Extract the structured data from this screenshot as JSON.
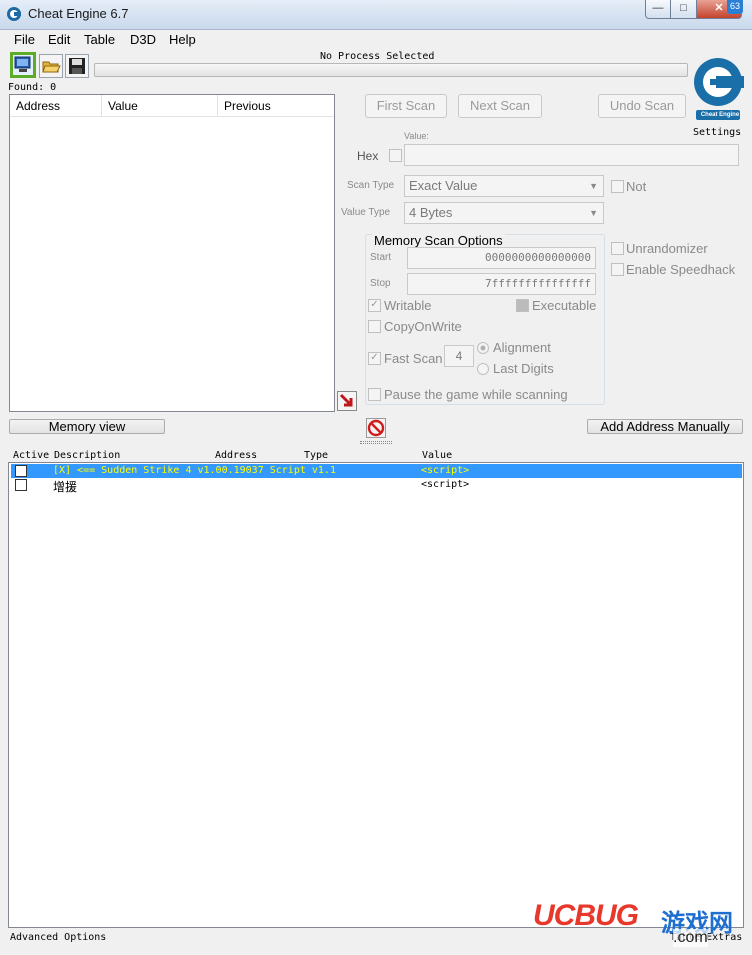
{
  "window": {
    "title": "Cheat Engine 6.7",
    "minimize": "—",
    "maximize": "□",
    "close": "✕",
    "corner_badge": "63"
  },
  "menu": {
    "file": "File",
    "edit": "Edit",
    "table": "Table",
    "d3d": "D3D",
    "help": "Help"
  },
  "toolbar": {
    "open_process_icon": "computer-icon",
    "open_file_icon": "folder-open-icon",
    "save_icon": "floppy-disk-icon",
    "process_label": "No Process Selected",
    "progress": 0
  },
  "found": "Found: 0",
  "logo": {
    "text": "Cheat Engine",
    "settings": "Settings"
  },
  "results": {
    "columns": [
      "Address",
      "Value",
      "Previous"
    ]
  },
  "scan": {
    "first_scan": "First Scan",
    "next_scan": "Next Scan",
    "undo_scan": "Undo Scan",
    "value_label": "Value:",
    "hex_label": "Hex",
    "scan_type_label": "Scan Type",
    "scan_type_value": "Exact Value",
    "not_label": "Not",
    "value_type_label": "Value Type",
    "value_type_value": "4 Bytes"
  },
  "memory_options": {
    "title": "Memory Scan Options",
    "start_label": "Start",
    "start_value": "0000000000000000",
    "stop_label": "Stop",
    "stop_value": "7fffffffffffffff",
    "writable": "Writable",
    "executable": "Executable",
    "copy_on_write": "CopyOnWrite",
    "fast_scan": "Fast Scan",
    "fast_scan_value": "4",
    "alignment": "Alignment",
    "last_digits": "Last Digits",
    "pause": "Pause the game while scanning"
  },
  "extra": {
    "unrandomizer": "Unrandomizer",
    "speedhack": "Enable Speedhack"
  },
  "memory_view": "Memory view",
  "add_address": "Add Address Manually",
  "address_list": {
    "columns": [
      "Active",
      "Description",
      "Address",
      "Type",
      "Value"
    ],
    "rows": [
      {
        "description": "[X] <== Sudden Strike 4 v1.00.19037 Script v1.1",
        "value": "<script>"
      },
      {
        "description": "增援",
        "value": "<script>"
      }
    ]
  },
  "status": {
    "advanced": "Advanced Options",
    "table_extras": "Table Extras"
  },
  "watermark": {
    "brand": "UCBUG",
    "cn": "游戏网",
    "com": ".com"
  },
  "colors": {
    "selection": "#3399ff",
    "selection_text": "#ffff00",
    "process_button_border": "#5cac27",
    "brand_red": "#e8382c",
    "brand_blue": "#1f6fd1"
  }
}
